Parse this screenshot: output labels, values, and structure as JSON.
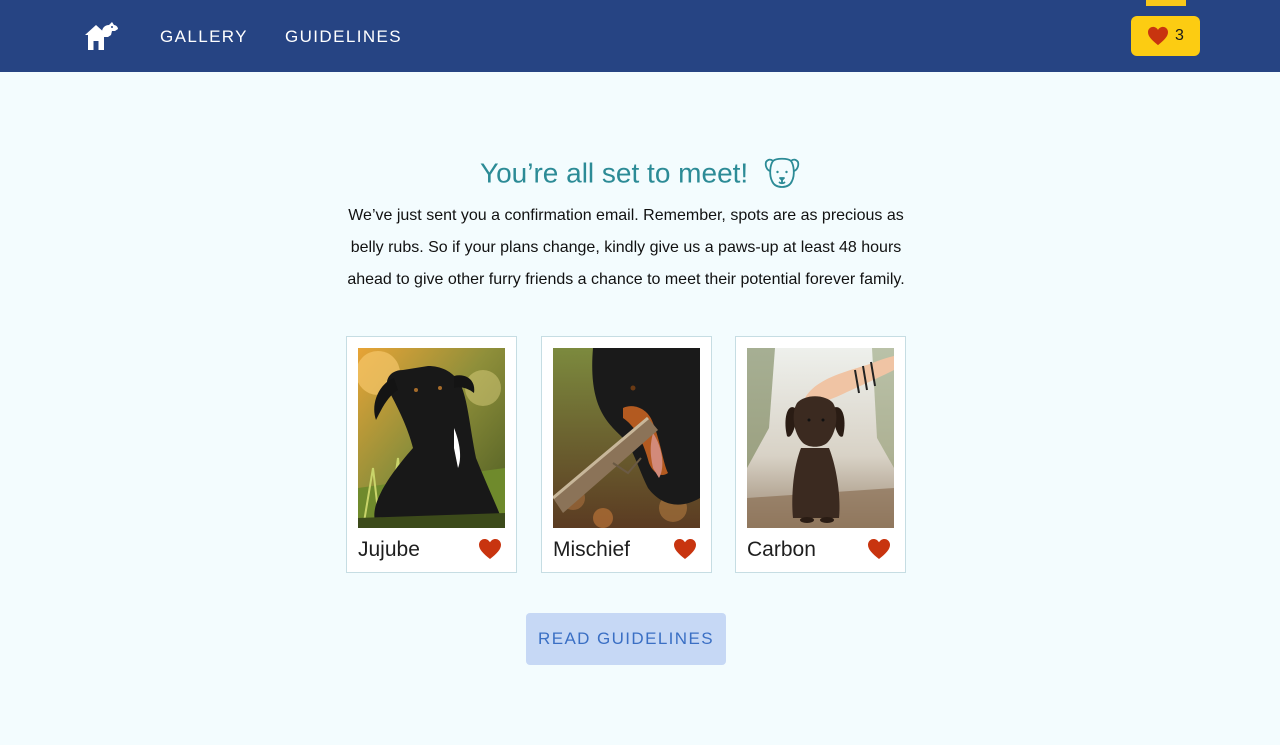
{
  "nav": {
    "logo_icon": "dog-house-icon",
    "links": [
      {
        "label": "GALLERY"
      },
      {
        "label": "GUIDELINES"
      }
    ],
    "favorites": {
      "icon": "heart-icon",
      "count": "3"
    }
  },
  "main": {
    "title": "You’re all set to meet!",
    "title_icon": "dog-face-icon",
    "message_lines": [
      "We’ve just sent you a confirmation email. Remember, spots are as precious as",
      "belly rubs. So if your plans change, kindly give us a paws-up at least 48 hours",
      "ahead to give other furry friends a chance to meet their potential forever family."
    ],
    "dogs": [
      {
        "name": "Jujube",
        "favorited": true
      },
      {
        "name": "Mischief",
        "favorited": true
      },
      {
        "name": "Carbon",
        "favorited": true
      }
    ],
    "cta_label": "READ GUIDELINES"
  },
  "colors": {
    "nav_bg": "#264483",
    "accent_yellow": "#fccc12",
    "heading_teal": "#2c8b96",
    "heart_red": "#c8340f",
    "button_bg": "#c6d8f5",
    "button_text": "#3a6fc4",
    "page_bg": "#f3fcfe"
  }
}
